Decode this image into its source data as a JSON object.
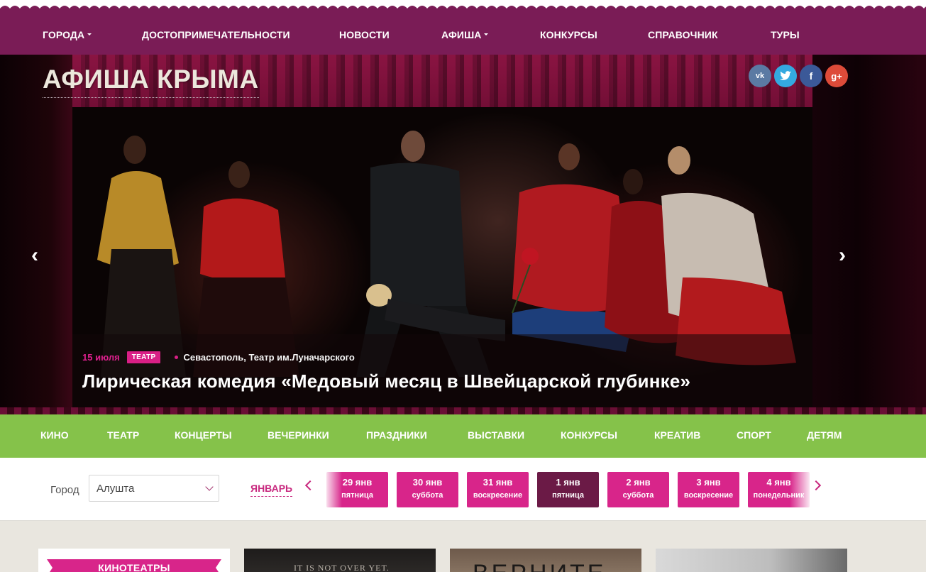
{
  "top_nav": {
    "items": [
      {
        "label": "ГОРОДА",
        "dropdown": true
      },
      {
        "label": "ДОСТОПРИМЕЧАТЕЛЬНОСТИ",
        "dropdown": false
      },
      {
        "label": "НОВОСТИ",
        "dropdown": false
      },
      {
        "label": "АФИША",
        "dropdown": true
      },
      {
        "label": "КОНКУРСЫ",
        "dropdown": false
      },
      {
        "label": "СПРАВОЧНИК",
        "dropdown": false
      },
      {
        "label": "ТУРЫ",
        "dropdown": false
      }
    ],
    "bg_color": "#7a1c56"
  },
  "header": {
    "site_title": "АФИША КРЫМА",
    "social": [
      {
        "name": "vk-icon",
        "glyph": "vk",
        "color": "#5b7aa3"
      },
      {
        "name": "twitter-icon",
        "glyph": "🐦",
        "color": "#34a9e0"
      },
      {
        "name": "facebook-icon",
        "glyph": "f",
        "color": "#3b5998"
      },
      {
        "name": "google-plus-icon",
        "glyph": "g+",
        "color": "#dd4b39"
      }
    ]
  },
  "slider": {
    "prev_icon": "‹",
    "next_icon": "›",
    "slide": {
      "date": "15 июля",
      "tag": "ТЕАТР",
      "place": "Севастополь, Театр им.Луначарского",
      "title": "Лирическая комедия «Медовый месяц в Швейцарской глубинке»"
    }
  },
  "categories": [
    "КИНО",
    "ТЕАТР",
    "КОНЦЕРТЫ",
    "ВЕЧЕРИНКИ",
    "ПРАЗДНИКИ",
    "ВЫСТАВКИ",
    "КОНКУРСЫ",
    "КРЕАТИВ",
    "СПОРТ",
    "ДЕТЯМ"
  ],
  "category_bar_color": "#85c24a",
  "filter": {
    "city_label": "Город",
    "city_value": "Алушта",
    "month": "ЯНВАРЬ",
    "dates": [
      {
        "day": "29 янв",
        "weekday": "пятница",
        "active": false
      },
      {
        "day": "30 янв",
        "weekday": "суббота",
        "active": false
      },
      {
        "day": "31 янв",
        "weekday": "воскресение",
        "active": false
      },
      {
        "day": "1 янв",
        "weekday": "пятница",
        "active": true
      },
      {
        "day": "2 янв",
        "weekday": "суббота",
        "active": false
      },
      {
        "day": "3 янв",
        "weekday": "воскресение",
        "active": false
      },
      {
        "day": "4 янв",
        "weekday": "понедельник",
        "active": false
      }
    ],
    "accent_color": "#d8258a",
    "active_color": "#6b1a46"
  },
  "content": {
    "cinema_ribbon": "КИНОТЕАТРЫ",
    "thumb1_text": "IT IS NOT OVER YET.",
    "thumb2_text": "ВЕРНИТЕ"
  }
}
